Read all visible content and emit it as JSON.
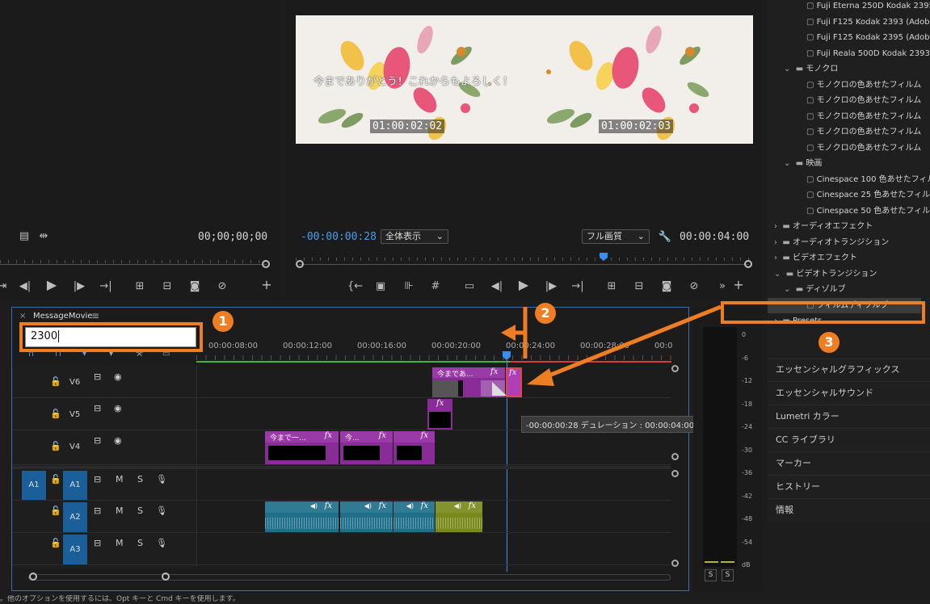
{
  "source_monitor": {
    "timecode": "00;00;00;00"
  },
  "program_monitor": {
    "caption_left": "今までありがとう！これからもよろしく！",
    "timecode_left": "01:00:02:02",
    "timecode_right": "01:00:02:03",
    "current_time": "-00:00:00:28",
    "zoom": "全体表示",
    "quality": "フル画質",
    "duration": "00:00:04:00"
  },
  "effects_panel": {
    "items": [
      {
        "label": "Fuji Eterna 250D Kodak 2395 (A",
        "level": 3
      },
      {
        "label": "Fuji F125 Kodak 2393 (Adobe)",
        "level": 3
      },
      {
        "label": "Fuji F125 Kodak 2395 (Adobe)",
        "level": 3
      },
      {
        "label": "Fuji Reala 500D Kodak 2393 (A",
        "level": 3
      },
      {
        "label": "モノクロ",
        "level": 2,
        "folder": true,
        "open": true
      },
      {
        "label": "モノクロの色あせたフィルム",
        "level": 3
      },
      {
        "label": "モノクロの色あせたフィルム",
        "level": 3
      },
      {
        "label": "モノクロの色あせたフィルム",
        "level": 3
      },
      {
        "label": "モノクロの色あせたフィルム",
        "level": 3
      },
      {
        "label": "モノクロの色あせたフィルム",
        "level": 3
      },
      {
        "label": "映画",
        "level": 2,
        "folder": true,
        "open": true
      },
      {
        "label": "Cinespace 100 色あせたフィル",
        "level": 3
      },
      {
        "label": "Cinespace 25 色あせたフィル",
        "level": 3
      },
      {
        "label": "Cinespace 50 色あせたフィル",
        "level": 3
      },
      {
        "label": "オーディオエフェクト",
        "level": 1,
        "folder": true,
        "open": false
      },
      {
        "label": "オーディオトランジション",
        "level": 1,
        "folder": true,
        "open": false
      },
      {
        "label": "ビデオエフェクト",
        "level": 1,
        "folder": true,
        "open": false
      },
      {
        "label": "ビデオトランジション",
        "level": 1,
        "folder": true,
        "open": true
      },
      {
        "label": "ディゾルブ",
        "level": 2,
        "folder": true,
        "open": true
      },
      {
        "label": "フィルムディゾルブ",
        "level": 3,
        "selected": true
      },
      {
        "label": "Presets",
        "level": 1,
        "folder": true,
        "open": false
      }
    ],
    "panels": [
      "エッセンシャルグラフィックス",
      "エッセンシャルサウンド",
      "Lumetri カラー",
      "CC ライブラリ",
      "マーカー",
      "ヒストリー",
      "情報"
    ]
  },
  "timeline": {
    "tab_label": "MessageMovie",
    "timecode_input": "2300",
    "ruler_labels": [
      "00:00:08:00",
      "00:00:12:00",
      "00:00:16:00",
      "00:00:20:00",
      "00:00:24:00",
      "00:00:28:00",
      "00:0"
    ],
    "video_tracks": [
      "V6",
      "V5",
      "V4"
    ],
    "audio_tracks": [
      "A1",
      "A2",
      "A3"
    ],
    "source_patch": "A1",
    "mute_label": "M",
    "solo_label": "S",
    "tooltip": "-00:00:00:28 デュレーション : 00:00:04:00",
    "clips": {
      "v6_title": "今まであ...",
      "v4_titles": [
        "今まで一...",
        "今...",
        ""
      ]
    },
    "fx_label": "fx"
  },
  "meter": {
    "scale": [
      "0",
      "-6",
      "-12",
      "-18",
      "-24",
      "-30",
      "-36",
      "-42",
      "-48",
      "-54",
      "dB"
    ],
    "solo_buttons": [
      "S",
      "S"
    ]
  },
  "status_bar": {
    "text": "。他のオプションを使用するには、Opt キーと Cmd キーを使用します。"
  },
  "annotations": {
    "step1": "1",
    "step2": "2",
    "step3": "3",
    "accent": "#ef7d22"
  },
  "colors": {
    "clip_video": "#8a2c97",
    "clip_audio": "#1f6f8b",
    "clip_audio_alt": "#7a8a1a",
    "timecode_blue": "#4a9cf0",
    "track_blue": "#1b5f9a"
  }
}
